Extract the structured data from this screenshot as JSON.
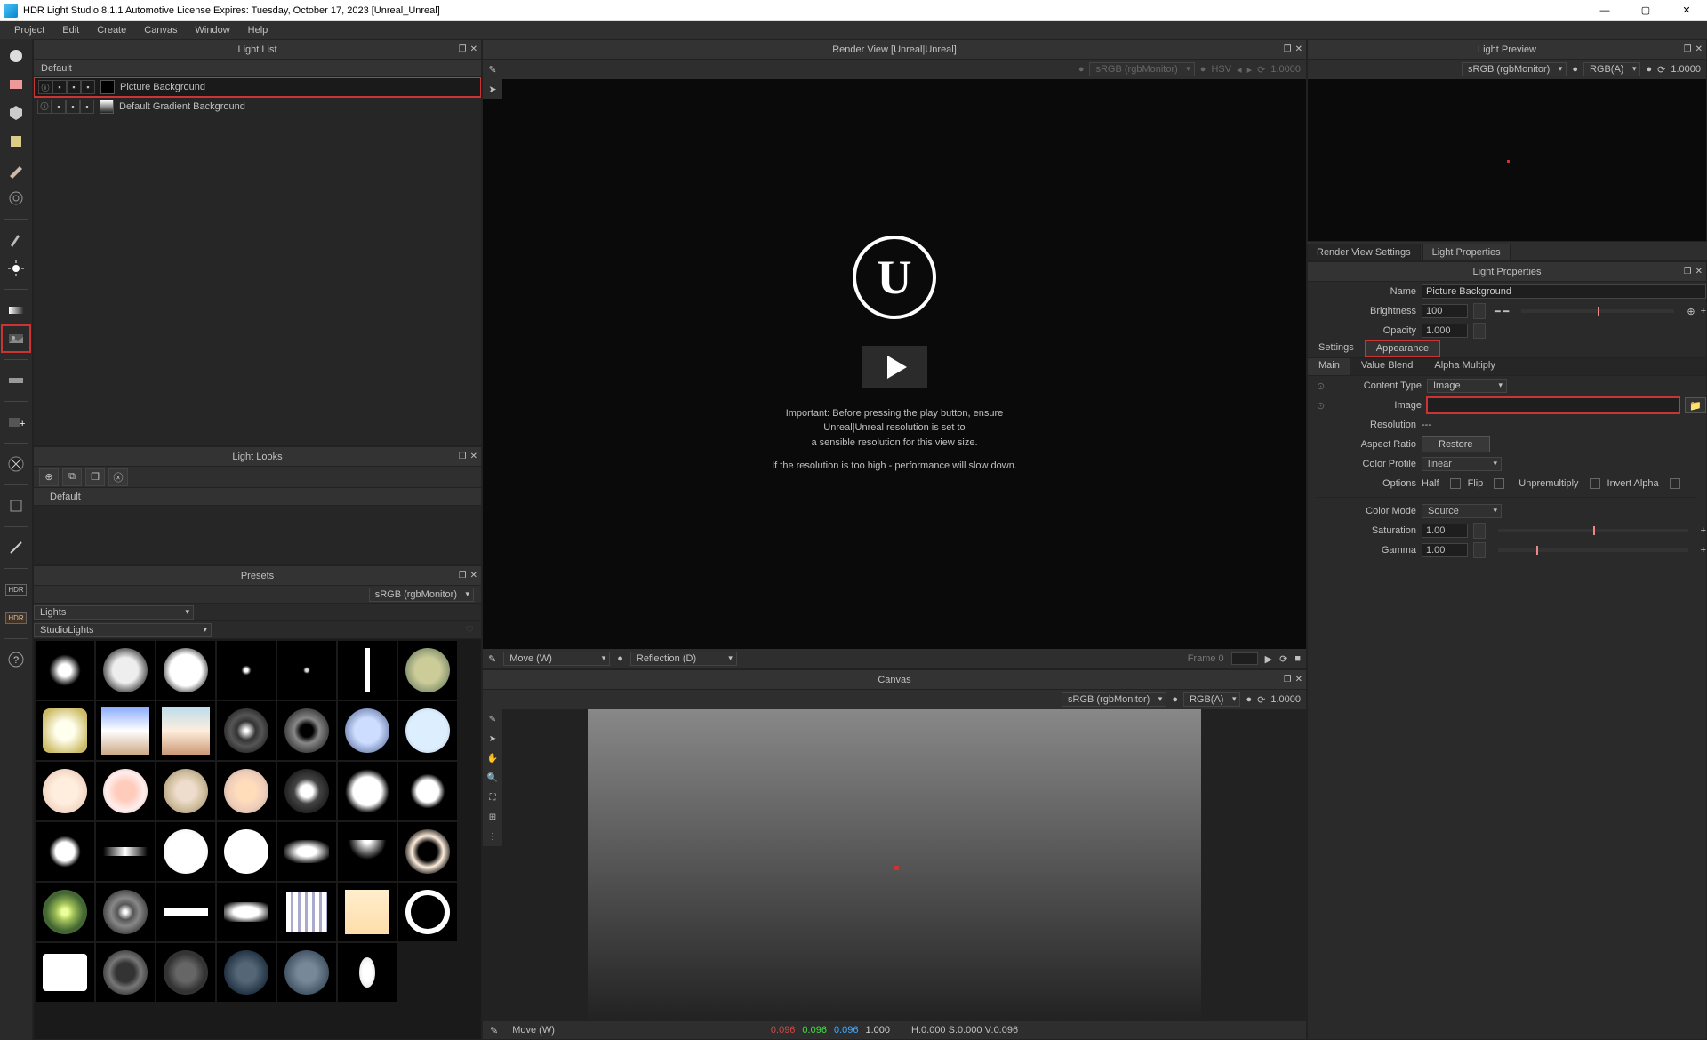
{
  "title": "HDR Light Studio 8.1.1  Automotive License Expires: Tuesday, October 17, 2023   [Unreal_Unreal]",
  "menu": [
    "Project",
    "Edit",
    "Create",
    "Canvas",
    "Window",
    "Help"
  ],
  "panels": {
    "lightList": {
      "title": "Light List",
      "group": "Default",
      "rows": [
        {
          "name": "Picture Background",
          "selected": true
        },
        {
          "name": "Default Gradient Background",
          "selected": false
        }
      ]
    },
    "lightLooks": {
      "title": "Light Looks",
      "row": "Default"
    },
    "presets": {
      "title": "Presets",
      "colorSpace": "sRGB (rgbMonitor)",
      "combo1": "Lights",
      "combo2": "StudioLights"
    },
    "renderView": {
      "title": "Render View [Unreal|Unreal]",
      "colorSpace": "sRGB (rgbMonitor)",
      "mode": "HSV",
      "exposure": "1.0000",
      "msg1": "Important: Before pressing the play button, ensure",
      "msg2": "Unreal|Unreal resolution is set to",
      "msg3": "a sensible resolution for this view size.",
      "msg4": "If the resolution is too high - performance will slow down."
    },
    "transport": {
      "move": "Move (W)",
      "mode": "Reflection (D)",
      "frame": "Frame 0"
    },
    "canvas": {
      "title": "Canvas",
      "colorSpace": "sRGB (rgbMonitor)",
      "channel": "RGB(A)",
      "exposure": "1.0000"
    },
    "lightPreview": {
      "title": "Light Preview",
      "colorSpace": "sRGB (rgbMonitor)",
      "channel": "RGB(A)",
      "exposure": "1.0000"
    },
    "tabs": {
      "t1": "Render View Settings",
      "t2": "Light Properties"
    },
    "lightProps": {
      "header": "Light Properties",
      "name_lbl": "Name",
      "name": "Picture Background",
      "brightness_lbl": "Brightness",
      "brightness": "100",
      "opacity_lbl": "Opacity",
      "opacity": "1.000",
      "settings": "Settings",
      "appearance": "Appearance",
      "main": "Main",
      "valueBlend": "Value Blend",
      "alphaMult": "Alpha Multiply",
      "contentType_lbl": "Content Type",
      "contentType": "Image",
      "image_lbl": "Image",
      "resolution_lbl": "Resolution",
      "resolution": "---",
      "aspect_lbl": "Aspect Ratio",
      "restore": "Restore",
      "colorProfile_lbl": "Color Profile",
      "colorProfile": "linear",
      "options_lbl": "Options",
      "opt_half": "Half",
      "opt_flip": "Flip",
      "opt_unpre": "Unpremultiply",
      "opt_invert": "Invert Alpha",
      "colorMode_lbl": "Color Mode",
      "colorMode": "Source",
      "saturation_lbl": "Saturation",
      "saturation": "1.00",
      "gamma_lbl": "Gamma",
      "gamma": "1.00"
    }
  },
  "status": {
    "move": "Move (W)",
    "r": "0.096",
    "g": "0.096",
    "b": "0.096",
    "a": "1.000",
    "hsv": "H:0.000 S:0.000 V:0.096"
  }
}
